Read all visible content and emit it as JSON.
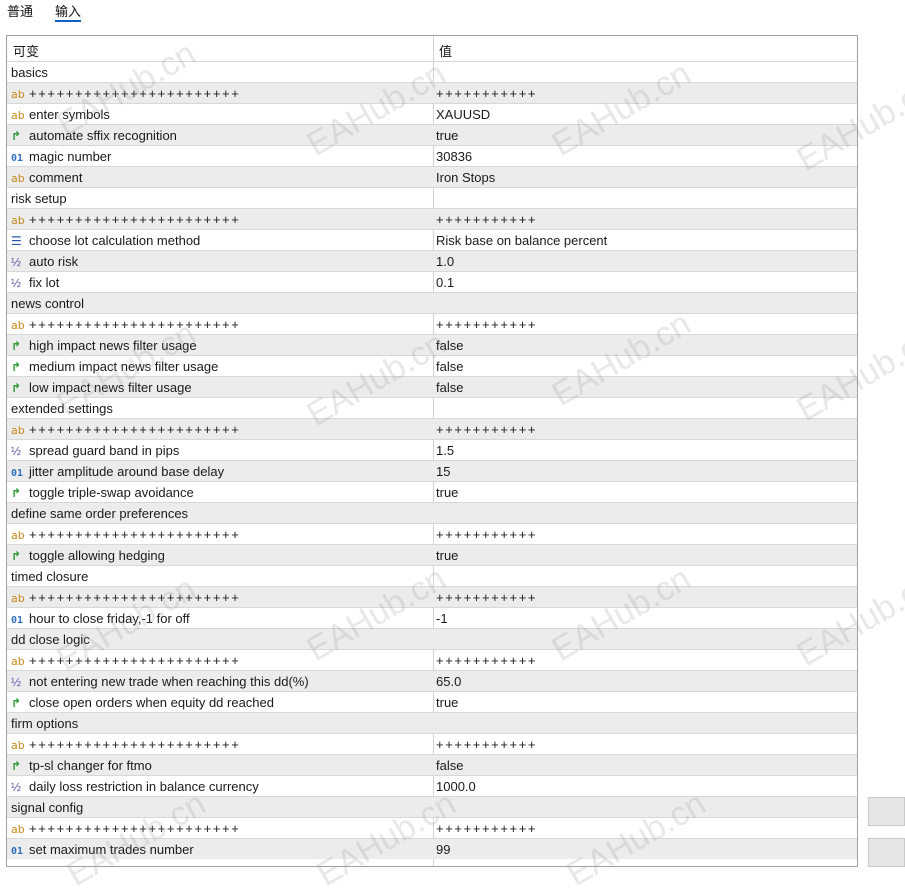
{
  "tabs": [
    {
      "label": "普通"
    },
    {
      "label": "输入"
    }
  ],
  "active_tab": 1,
  "table": {
    "col_variable": "可变",
    "col_value": "值",
    "rows": [
      {
        "type": "group",
        "name": "basics"
      },
      {
        "type": "ab",
        "name": "+++++++++++++++++++++++",
        "value": "+++++++++++"
      },
      {
        "type": "ab",
        "name": "enter symbols",
        "value": "XAUUSD"
      },
      {
        "type": "bool",
        "name": "automate sffix recognition",
        "value": "true"
      },
      {
        "type": "num",
        "name": "magic number",
        "value": "30836"
      },
      {
        "type": "ab",
        "name": "comment",
        "value": "Iron Stops"
      },
      {
        "type": "group",
        "name": "risk setup"
      },
      {
        "type": "ab",
        "name": "+++++++++++++++++++++++",
        "value": "+++++++++++"
      },
      {
        "type": "list",
        "name": "choose lot calculation method",
        "value": "Risk base on balance percent"
      },
      {
        "type": "frac",
        "name": "auto risk",
        "value": "1.0"
      },
      {
        "type": "frac",
        "name": "fix lot",
        "value": "0.1"
      },
      {
        "type": "group",
        "name": "news control"
      },
      {
        "type": "ab",
        "name": "+++++++++++++++++++++++",
        "value": "+++++++++++"
      },
      {
        "type": "bool",
        "name": "high impact news filter usage",
        "value": "false"
      },
      {
        "type": "bool",
        "name": "medium impact news filter usage",
        "value": "false"
      },
      {
        "type": "bool",
        "name": "low impact news filter usage",
        "value": "false"
      },
      {
        "type": "group",
        "name": "extended settings"
      },
      {
        "type": "ab",
        "name": "+++++++++++++++++++++++",
        "value": "+++++++++++"
      },
      {
        "type": "frac",
        "name": "spread guard band in pips",
        "value": "1.5"
      },
      {
        "type": "num",
        "name": "jitter amplitude around base delay",
        "value": "15"
      },
      {
        "type": "bool",
        "name": "toggle triple-swap avoidance",
        "value": "true"
      },
      {
        "type": "group",
        "name": "define same order preferences"
      },
      {
        "type": "ab",
        "name": "+++++++++++++++++++++++",
        "value": "+++++++++++"
      },
      {
        "type": "bool",
        "name": "toggle allowing hedging",
        "value": "true"
      },
      {
        "type": "group",
        "name": "timed closure"
      },
      {
        "type": "ab",
        "name": "+++++++++++++++++++++++",
        "value": "+++++++++++"
      },
      {
        "type": "num",
        "name": "hour to close friday,-1 for off",
        "value": "-1"
      },
      {
        "type": "group",
        "name": "dd close logic"
      },
      {
        "type": "ab",
        "name": "+++++++++++++++++++++++",
        "value": "+++++++++++"
      },
      {
        "type": "frac",
        "name": "not entering new trade when reaching this dd(%)",
        "value": "65.0"
      },
      {
        "type": "bool",
        "name": "close open orders when equity dd reached",
        "value": "true"
      },
      {
        "type": "group",
        "name": "firm options"
      },
      {
        "type": "ab",
        "name": "+++++++++++++++++++++++",
        "value": "+++++++++++"
      },
      {
        "type": "bool",
        "name": "tp-sl changer for ftmo",
        "value": "false"
      },
      {
        "type": "frac",
        "name": "daily loss restriction in balance currency",
        "value": "1000.0"
      },
      {
        "type": "group",
        "name": "signal config"
      },
      {
        "type": "ab",
        "name": "+++++++++++++++++++++++",
        "value": "+++++++++++"
      },
      {
        "type": "num",
        "name": "set maximum trades number",
        "value": "99"
      }
    ]
  },
  "icons": {
    "ab": {
      "glyph": "ab",
      "name": "string-type-icon"
    },
    "num": {
      "glyph": "01",
      "name": "integer-type-icon"
    },
    "bool": {
      "glyph": "↱",
      "name": "bool-type-icon"
    },
    "frac": {
      "glyph": "½",
      "name": "double-type-icon"
    },
    "list": {
      "glyph": "☰",
      "name": "enum-type-icon"
    }
  },
  "watermark": "EAHub.cn",
  "colors": {
    "accent": "#0a64c8",
    "row_alt": "#ececec"
  }
}
